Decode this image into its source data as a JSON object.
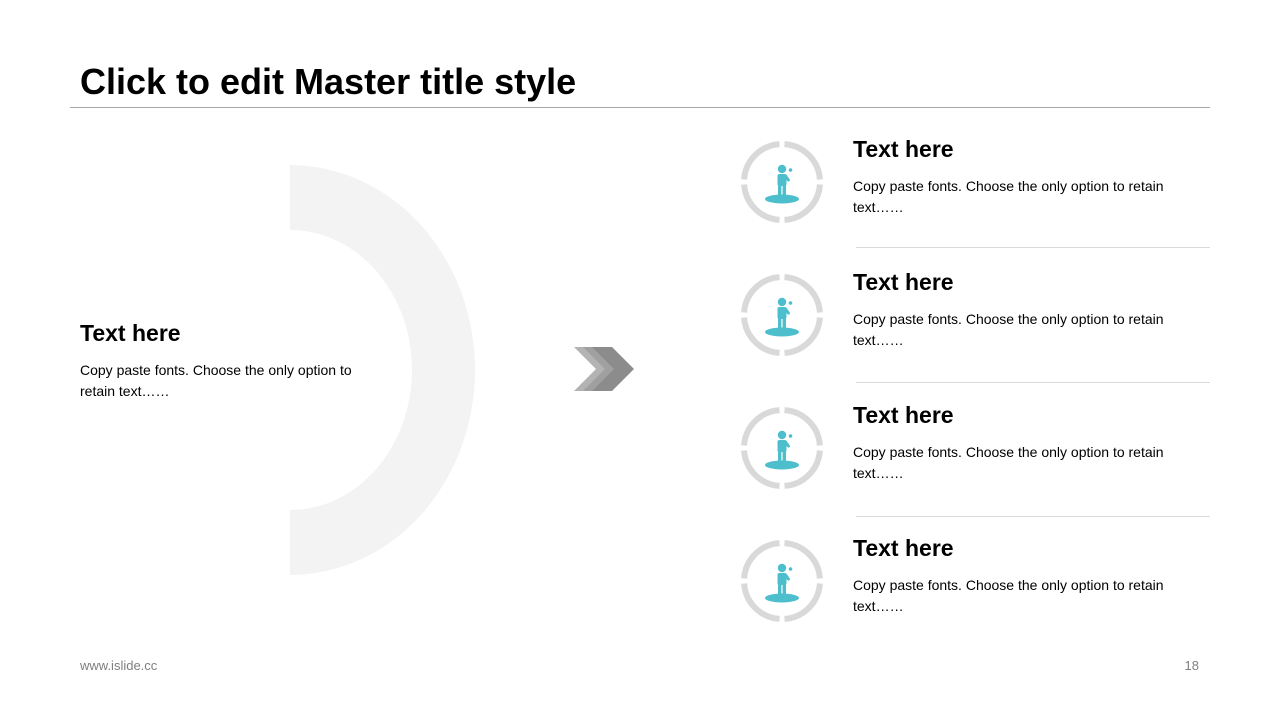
{
  "slide": {
    "title": "Click to edit Master title style",
    "left_block": {
      "heading": "Text here",
      "body": "Copy paste fonts. Choose the only option to retain text……"
    },
    "items": [
      {
        "heading": "Text here",
        "body": "Copy paste fonts. Choose the only option to retain text……",
        "icon": "person-on-pedestal-icon"
      },
      {
        "heading": "Text here",
        "body": "Copy paste fonts. Choose the only option to retain text……",
        "icon": "person-on-pedestal-icon"
      },
      {
        "heading": "Text here",
        "body": "Copy paste fonts. Choose the only option to retain text……",
        "icon": "person-on-pedestal-icon"
      },
      {
        "heading": "Text here",
        "body": "Copy paste fonts. Choose the only option to retain text……",
        "icon": "person-on-pedestal-icon"
      }
    ],
    "footer": {
      "url": "www.islide.cc",
      "page_number": "18"
    }
  },
  "colors": {
    "accent_teal": "#4dbfcc",
    "ring_gray": "#d9d9d9",
    "chevron_dark": "#8c8c8c",
    "chevron_light": "#b8b8b8",
    "arc_gray": "#f2f2f2"
  }
}
